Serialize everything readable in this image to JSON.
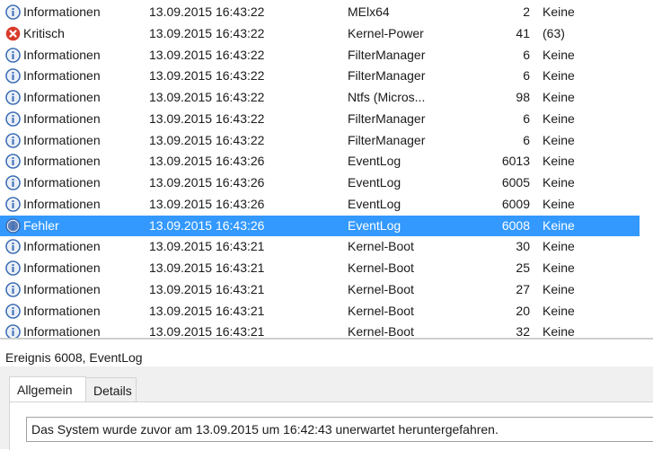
{
  "events": [
    {
      "level": "Informationen",
      "date": "13.09.2015 16:43:22",
      "source": "MElx64",
      "event_id": "2",
      "task": "Keine",
      "icon": "info-icon",
      "selected": false
    },
    {
      "level": "Kritisch",
      "date": "13.09.2015 16:43:22",
      "source": "Kernel-Power",
      "event_id": "41",
      "task": "(63)",
      "icon": "critical-icon",
      "selected": false
    },
    {
      "level": "Informationen",
      "date": "13.09.2015 16:43:22",
      "source": "FilterManager",
      "event_id": "6",
      "task": "Keine",
      "icon": "info-icon",
      "selected": false
    },
    {
      "level": "Informationen",
      "date": "13.09.2015 16:43:22",
      "source": "FilterManager",
      "event_id": "6",
      "task": "Keine",
      "icon": "info-icon",
      "selected": false
    },
    {
      "level": "Informationen",
      "date": "13.09.2015 16:43:22",
      "source": "Ntfs (Micros...",
      "event_id": "98",
      "task": "Keine",
      "icon": "info-icon",
      "selected": false
    },
    {
      "level": "Informationen",
      "date": "13.09.2015 16:43:22",
      "source": "FilterManager",
      "event_id": "6",
      "task": "Keine",
      "icon": "info-icon",
      "selected": false
    },
    {
      "level": "Informationen",
      "date": "13.09.2015 16:43:22",
      "source": "FilterManager",
      "event_id": "6",
      "task": "Keine",
      "icon": "info-icon",
      "selected": false
    },
    {
      "level": "Informationen",
      "date": "13.09.2015 16:43:26",
      "source": "EventLog",
      "event_id": "6013",
      "task": "Keine",
      "icon": "info-icon",
      "selected": false
    },
    {
      "level": "Informationen",
      "date": "13.09.2015 16:43:26",
      "source": "EventLog",
      "event_id": "6005",
      "task": "Keine",
      "icon": "info-icon",
      "selected": false
    },
    {
      "level": "Informationen",
      "date": "13.09.2015 16:43:26",
      "source": "EventLog",
      "event_id": "6009",
      "task": "Keine",
      "icon": "info-icon",
      "selected": false
    },
    {
      "level": "Fehler",
      "date": "13.09.2015 16:43:26",
      "source": "EventLog",
      "event_id": "6008",
      "task": "Keine",
      "icon": "info-icon",
      "selected": true
    },
    {
      "level": "Informationen",
      "date": "13.09.2015 16:43:21",
      "source": "Kernel-Boot",
      "event_id": "30",
      "task": "Keine",
      "icon": "info-icon",
      "selected": false
    },
    {
      "level": "Informationen",
      "date": "13.09.2015 16:43:21",
      "source": "Kernel-Boot",
      "event_id": "25",
      "task": "Keine",
      "icon": "info-icon",
      "selected": false
    },
    {
      "level": "Informationen",
      "date": "13.09.2015 16:43:21",
      "source": "Kernel-Boot",
      "event_id": "27",
      "task": "Keine",
      "icon": "info-icon",
      "selected": false
    },
    {
      "level": "Informationen",
      "date": "13.09.2015 16:43:21",
      "source": "Kernel-Boot",
      "event_id": "20",
      "task": "Keine",
      "icon": "info-icon",
      "selected": false
    },
    {
      "level": "Informationen",
      "date": "13.09.2015 16:43:21",
      "source": "Kernel-Boot",
      "event_id": "32",
      "task": "Keine",
      "icon": "info-icon",
      "selected": false
    }
  ],
  "detail": {
    "title": "Ereignis 6008, EventLog",
    "tabs": [
      {
        "label": "Allgemein",
        "active": true
      },
      {
        "label": "Details",
        "active": false
      }
    ],
    "message": "Das System wurde zuvor am 13.09.2015 um 16:42:43 unerwartet heruntergefahren."
  },
  "colors": {
    "selection": "#3399ff",
    "info_icon": "#3b6db5",
    "critical_icon": "#d93b2b"
  }
}
